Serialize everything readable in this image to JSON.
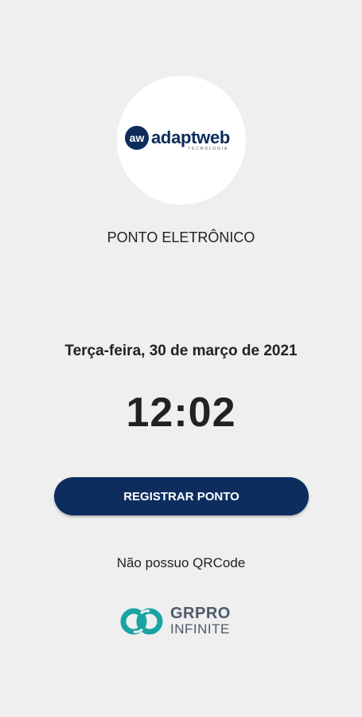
{
  "logo": {
    "mark": "aw",
    "word": "adaptweb",
    "tagline": "TECNOLOGIA"
  },
  "app": {
    "title": "PONTO ELETRÔNICO"
  },
  "clock": {
    "date": "Terça-feira, 30 de março de 2021",
    "time": "12:02"
  },
  "actions": {
    "register_label": "REGISTRAR PONTO",
    "no_qrcode_label": "Não possuo QRCode"
  },
  "footer": {
    "brand": "GRPRO",
    "sub": "INFINITE",
    "icon": "infinity-rings-icon"
  },
  "colors": {
    "background": "#efefef",
    "primary": "#0c2d5e",
    "footer_icon": "#1aa3a3"
  }
}
